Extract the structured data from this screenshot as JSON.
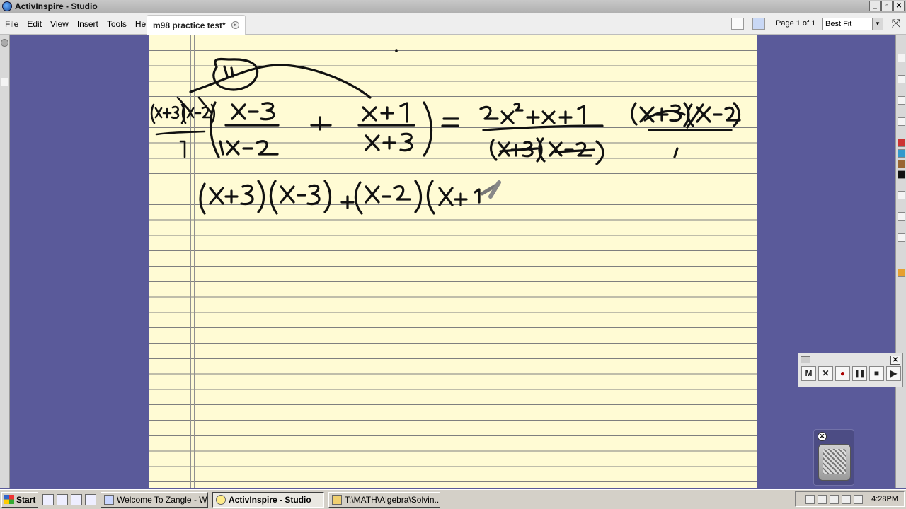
{
  "window": {
    "title": "ActivInspire - Studio",
    "buttons": [
      "_",
      "▫",
      "✕"
    ]
  },
  "menu": {
    "items": [
      "File",
      "Edit",
      "View",
      "Insert",
      "Tools",
      "Help"
    ]
  },
  "document": {
    "tab_label": "m98 practice test*"
  },
  "toolbar": {
    "page_label": "Page 1 of 1",
    "zoom_value": "Best Fit"
  },
  "colors": {
    "paper": "#fffbd4",
    "rule_lines": "#7f7f7f",
    "ink": "#111111",
    "desktop": "#5a5a9a"
  },
  "recorder": {
    "buttons": [
      "M",
      "✕",
      "●",
      "❚❚",
      "■",
      "▶"
    ]
  },
  "taskbar": {
    "start_label": "Start",
    "tasks": [
      {
        "label": "Welcome To Zangle - Wi...",
        "active": false
      },
      {
        "label": "ActivInspire - Studio",
        "active": true
      },
      {
        "label": "T:\\MATH\\Algebra\\Solvin...",
        "active": false
      }
    ],
    "clock": "4:28PM"
  },
  "handwriting": {
    "lhs_multiplier": "(x+3)(x-2)",
    "fraction1_num": "x-3",
    "fraction1_den": "x-2",
    "fraction2_num": "x+1",
    "fraction2_den": "x+3",
    "rhs_num": "2x²+x+1",
    "rhs_den": "(x+3)(x-2)",
    "rhs_multiplier": "(x+3)(x-2)",
    "work_line": "(x+3)(x-3) + (x-2)(x+1"
  }
}
